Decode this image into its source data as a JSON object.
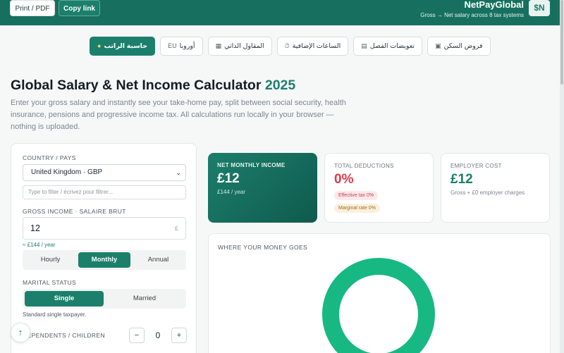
{
  "header": {
    "print_label": "Print / PDF",
    "copy_label": "Copy link",
    "brand_name": "NetPayGlobal",
    "brand_tagline": "Gross → Net salary across 8 tax systems",
    "badge": "$N"
  },
  "tabs": [
    {
      "label": "فروض السكن",
      "icon": "house-calculator-icon"
    },
    {
      "label": "تعويضات الفصل",
      "icon": "document-icon"
    },
    {
      "label": "الساعات الإضافية",
      "icon": "stopwatch-icon"
    },
    {
      "label": "المقاول الذاتي",
      "icon": "calculator-icon"
    },
    {
      "label": "أوروبا",
      "icon": "eu-icon",
      "icon_text": "EU"
    },
    {
      "label": "حاسبة الراتب",
      "icon": "money-bag-icon",
      "active": true
    }
  ],
  "page": {
    "title_main": "Global Salary & Net Income Calculator",
    "title_year": "2025",
    "intro": "Enter your gross salary and instantly see your take-home pay, split between social security, health insurance, pensions and progressive income tax. All calculations run locally in your browser — nothing is uploaded."
  },
  "form": {
    "country_label": "COUNTRY / PAYS",
    "country_value": "United Kingdom · GBP",
    "filter_placeholder": "Type to filter / écrivez pour filtrer...",
    "gross_label": "GROSS INCOME · SALAIRE BRUT",
    "gross_value": "12",
    "currency_symbol": "£",
    "per_year": "≈ £144 / year",
    "periods": [
      "Hourly",
      "Monthly",
      "Annual"
    ],
    "period_selected": "Monthly",
    "marital_label": "MARITAL STATUS",
    "marital_options": [
      "Single",
      "Married"
    ],
    "marital_selected": "Single",
    "marital_hint": "Standard single taxpayer.",
    "dependents_label": "DEPENDENTS / CHILDREN",
    "dependents_value": "0"
  },
  "stats": {
    "net": {
      "label": "NET MONTHLY INCOME",
      "value": "£12",
      "sub": "£144 / year"
    },
    "deductions": {
      "label": "TOTAL DEDUCTIONS",
      "value": "0%",
      "effective": "Effective tax 0%",
      "marginal": "Marginal rate 0%"
    },
    "employer": {
      "label": "EMPLOYER COST",
      "value": "£12",
      "sub": "Gross + £0 employer charges"
    }
  },
  "breakdown": {
    "title": "WHERE YOUR MONEY GOES",
    "net_share_percent": 100,
    "color_net": "#17b882"
  },
  "colors": {
    "brand": "#17705f",
    "accent": "#1b7f6c",
    "danger": "#e0394a"
  }
}
